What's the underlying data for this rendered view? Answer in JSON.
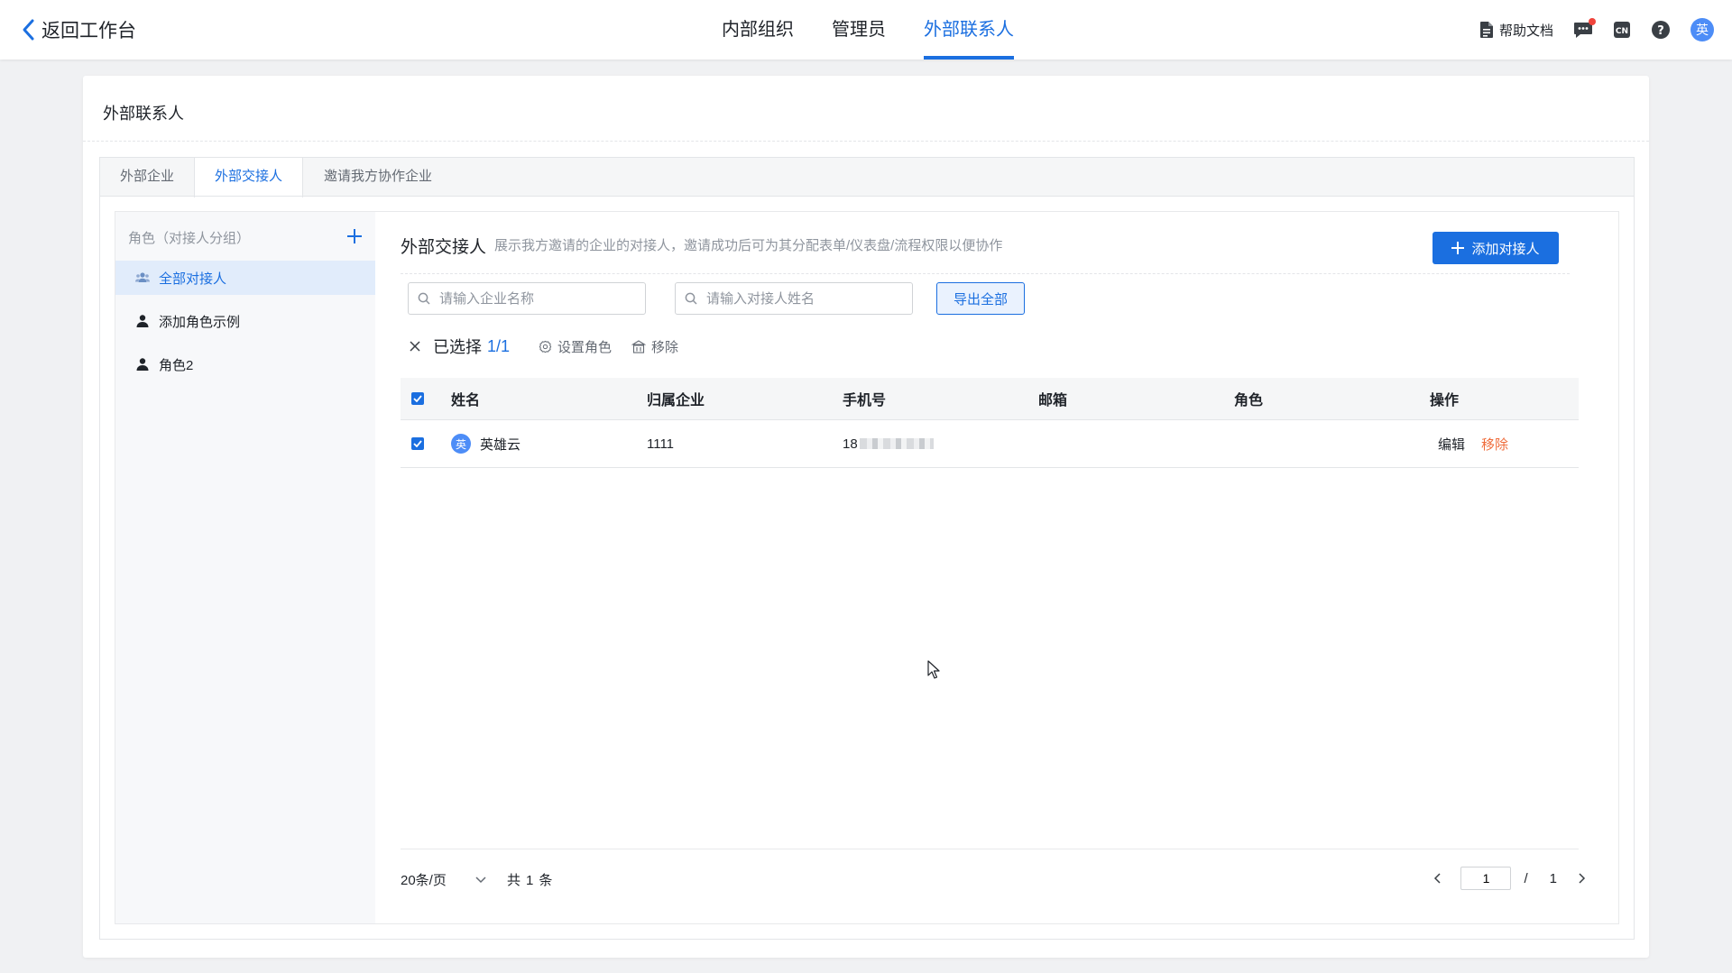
{
  "topbar": {
    "back_label": "返回工作台",
    "nav": [
      {
        "label": "内部组织",
        "active": false
      },
      {
        "label": "管理员",
        "active": false
      },
      {
        "label": "外部联系人",
        "active": true
      }
    ],
    "help_doc_label": "帮助文档",
    "avatar_text": "英",
    "lang_icon": "cn-language-icon"
  },
  "page": {
    "title": "外部联系人",
    "tabs": [
      {
        "label": "外部企业",
        "active": false
      },
      {
        "label": "外部交接人",
        "active": true
      },
      {
        "label": "邀请我方协作企业",
        "active": false
      }
    ]
  },
  "sidebar": {
    "header": "角色（对接人分组）",
    "items": [
      {
        "label": "全部对接人",
        "icon": "group-icon",
        "active": true
      },
      {
        "label": "添加角色示例",
        "icon": "user-icon",
        "active": false
      },
      {
        "label": "角色2",
        "icon": "user-icon",
        "active": false
      }
    ]
  },
  "content": {
    "title": "外部交接人",
    "description": "展示我方邀请的企业的对接人，邀请成功后可为其分配表单/仪表盘/流程权限以便协作",
    "add_button": "添加对接人",
    "search_company_placeholder": "请输入企业名称",
    "search_contact_placeholder": "请输入对接人姓名",
    "export_button": "导出全部",
    "selection": {
      "label": "已选择",
      "count": "1/1",
      "set_role": "设置角色",
      "remove": "移除"
    },
    "table": {
      "columns": [
        "姓名",
        "归属企业",
        "手机号",
        "邮箱",
        "角色",
        "操作"
      ],
      "rows": [
        {
          "checked": true,
          "avatar": "英",
          "name": "英雄云",
          "company": "1111",
          "phone_prefix": "18",
          "email": "",
          "role": "",
          "edit": "编辑",
          "remove": "移除"
        }
      ]
    },
    "pagination": {
      "page_size": "20条/页",
      "total_prefix": "共",
      "total": "1",
      "total_suffix": "条",
      "current_page": "1",
      "slash": "/",
      "total_pages": "1"
    }
  },
  "colors": {
    "primary": "#1b6fe0",
    "danger": "#ef6c3b",
    "background": "#f0f1f3",
    "notification_dot": "#f0443c"
  }
}
